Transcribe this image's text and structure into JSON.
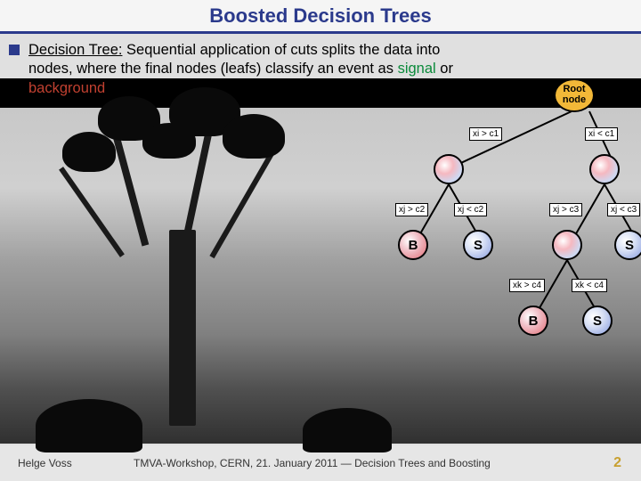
{
  "title": "Boosted Decision Trees",
  "bullet": {
    "lead": "Decision Tree:",
    "rest1": " Sequential application of cuts splits the data into nodes, where the final nodes (leafs) classify an event as ",
    "signal": "signal",
    "or": " or ",
    "background": "background"
  },
  "tree": {
    "root": "Root node",
    "edges": {
      "e1": "xi > c1",
      "e2": "xi < c1",
      "e3": "xj > c2",
      "e4": "xj < c2",
      "e5": "xj > c3",
      "e6": "xj < c3",
      "e7": "xk > c4",
      "e8": "xk < c4"
    },
    "labels": {
      "B": "B",
      "S": "S"
    }
  },
  "footer": {
    "author": "Helge Voss",
    "center": "TMVA-Workshop, CERN,  21. January 2011  ― Decision Trees and Boosting",
    "page": "2"
  }
}
